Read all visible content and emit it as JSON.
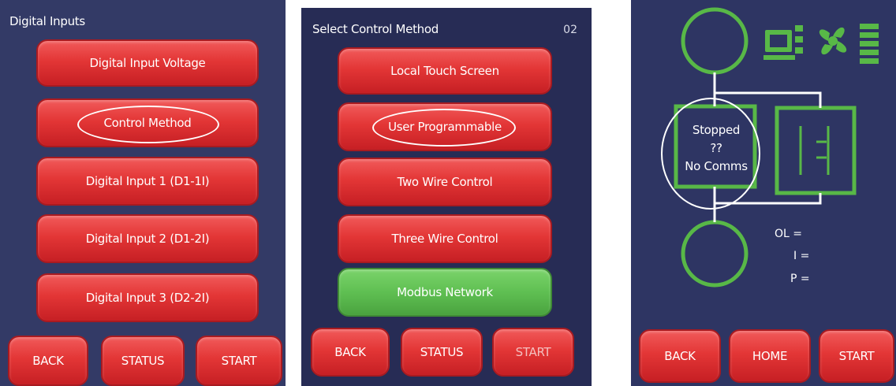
{
  "panel1": {
    "title": "Digital Inputs",
    "menu": [
      "Digital Input Voltage",
      "Control Method",
      "Digital Input 1 (D1-1I)",
      "Digital Input 2 (D1-2I)",
      "Digital Input 3 (D2-2I)"
    ],
    "nav": {
      "back": "BACK",
      "status": "STATUS",
      "start": "START"
    }
  },
  "panel2": {
    "title": "Select Control Method",
    "page_number": "02",
    "menu": [
      "Local Touch Screen",
      "User Programmable",
      "Two Wire Control",
      "Three Wire Control",
      "Modbus Network"
    ],
    "selected": "Modbus Network",
    "nav": {
      "back": "BACK",
      "status": "STATUS",
      "start": "START"
    }
  },
  "panel3": {
    "status": {
      "line1": "Stopped",
      "line2": "??",
      "line3": "No Comms"
    },
    "readouts": {
      "ol": "OL =",
      "i": "I =",
      "p": "P ="
    },
    "nav": {
      "back": "BACK",
      "home": "HOME",
      "start": "START"
    }
  },
  "colors": {
    "button_red": "#e33636",
    "button_green": "#5fbf52",
    "diagram_green": "#58b847",
    "screen_blue": "#2e3563",
    "highlight_oval": "#ffffff"
  },
  "icons": [
    "computer-network-icon",
    "fan-icon",
    "heater-icon"
  ]
}
